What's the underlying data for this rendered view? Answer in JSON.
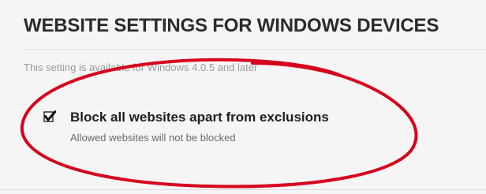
{
  "section": {
    "title": "WEBSITE SETTINGS FOR WINDOWS DEVICES",
    "availability_note": "This setting is available for Windows 4.0.5 and later"
  },
  "option": {
    "label": "Block all websites apart from exclusions",
    "description": "Allowed websites will not be blocked",
    "selected": true,
    "icon": "checkbox-checked-icon"
  },
  "colors": {
    "annotation": "#d6001c",
    "title": "#2b2b2b",
    "note": "#9a9a9a"
  }
}
